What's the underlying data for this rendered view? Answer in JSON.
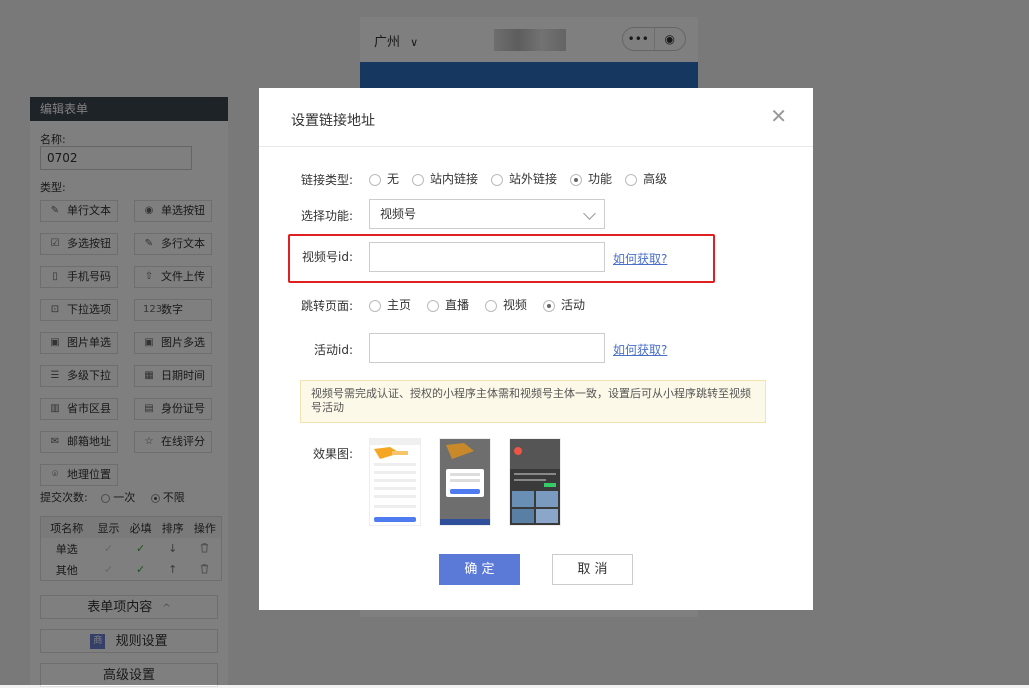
{
  "left_panel": {
    "title": "编辑表单",
    "name_label": "名称:",
    "name_value": "0702",
    "type_label": "类型:",
    "types": [
      {
        "label": "单行文本",
        "icon": "single-line-text-icon",
        "glyph": "✎"
      },
      {
        "label": "单选按钮",
        "icon": "radio-button-icon",
        "glyph": "◉"
      },
      {
        "label": "多选按钮",
        "icon": "checkbox-icon",
        "glyph": "☑"
      },
      {
        "label": "多行文本",
        "icon": "multi-line-text-icon",
        "glyph": "✎"
      },
      {
        "label": "手机号码",
        "icon": "mobile-phone-icon",
        "glyph": "▯"
      },
      {
        "label": "文件上传",
        "icon": "upload-icon",
        "glyph": "⇧"
      },
      {
        "label": "下拉选项",
        "icon": "dropdown-icon",
        "glyph": "⊡"
      },
      {
        "label": "数字",
        "icon": "number-icon",
        "glyph": "123"
      },
      {
        "label": "图片单选",
        "icon": "image-single-icon",
        "glyph": "▣"
      },
      {
        "label": "图片多选",
        "icon": "image-multi-icon",
        "glyph": "▣"
      },
      {
        "label": "多级下拉",
        "icon": "multi-level-dropdown-icon",
        "glyph": "☰"
      },
      {
        "label": "日期时间",
        "icon": "calendar-icon",
        "glyph": "▦"
      },
      {
        "label": "省市区县",
        "icon": "building-icon",
        "glyph": "▥"
      },
      {
        "label": "身份证号",
        "icon": "id-card-icon",
        "glyph": "▤"
      },
      {
        "label": "邮箱地址",
        "icon": "email-icon",
        "glyph": "✉"
      },
      {
        "label": "在线评分",
        "icon": "star-icon",
        "glyph": "☆"
      },
      {
        "label": "地理位置",
        "icon": "location-pin-icon",
        "glyph": "⌾"
      }
    ],
    "submit_label": "提交次数:",
    "submit_options": [
      "一次",
      "不限"
    ],
    "submit_selected": "不限",
    "table_headers": [
      "项名称",
      "显示",
      "必填",
      "排序",
      "操作"
    ],
    "table_rows": [
      {
        "name": "单选",
        "sort_glyph": "↓"
      },
      {
        "name": "其他",
        "sort_glyph": "↑"
      }
    ],
    "section_buttons": {
      "form_items": "表单项内容",
      "form_items_chevron": "^",
      "rules_badge": "商",
      "rules": "规则设置",
      "advanced": "高级设置"
    }
  },
  "phone": {
    "city": "广州",
    "city_chevron": "∨",
    "capsule_menu": "•••",
    "capsule_close": "◉"
  },
  "dialog": {
    "title": "设置链接地址",
    "close_glyph": "✕",
    "link_type_label": "链接类型:",
    "link_types": [
      "无",
      "站内链接",
      "站外链接",
      "功能",
      "高级"
    ],
    "link_type_selected": "功能",
    "function_label": "选择功能:",
    "function_value": "视频号",
    "channel_id_label": "视频号id:",
    "channel_id_value": "",
    "how_to_get": "如何获取?",
    "jump_label": "跳转页面:",
    "jump_options": [
      "主页",
      "直播",
      "视频",
      "活动"
    ],
    "jump_selected": "活动",
    "activity_id_label": "活动id:",
    "activity_id_value": "",
    "notice": "视频号需完成认证、授权的小程序主体需和视频号主体一致，设置后可从小程序跳转至视频号活动",
    "preview_label": "效果图:",
    "confirm": "确 定",
    "cancel": "取 消"
  },
  "colors": {
    "primary": "#5b7ad8",
    "link": "#4a6fc8",
    "highlight": "#e02020",
    "header_dark": "#3d4651",
    "check_green": "#3aaa35"
  }
}
